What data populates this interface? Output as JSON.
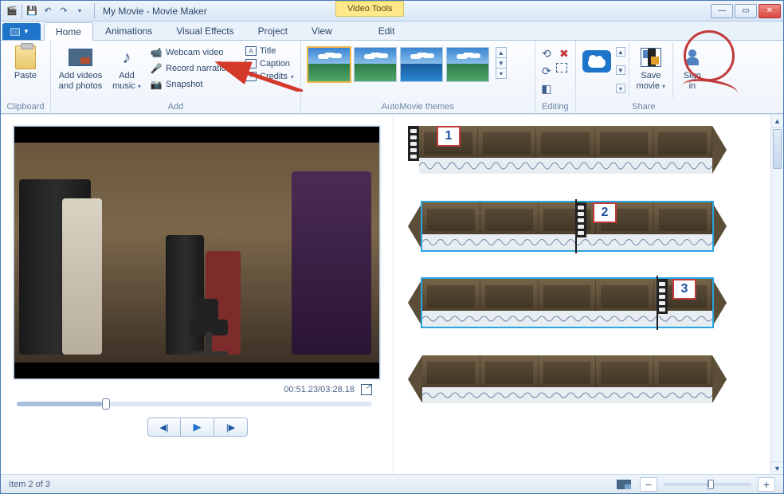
{
  "window_title": "My Movie - Movie Maker",
  "contextual_tab_header": "Video Tools",
  "tabs": {
    "home": "Home",
    "animations": "Animations",
    "visual_effects": "Visual Effects",
    "project": "Project",
    "view": "View",
    "edit": "Edit"
  },
  "ribbon": {
    "clipboard": {
      "paste": "Paste",
      "group": "Clipboard"
    },
    "add": {
      "add_videos": "Add videos\nand photos",
      "add_music": "Add\nmusic",
      "webcam": "Webcam video",
      "record": "Record narration",
      "snapshot": "Snapshot",
      "title": "Title",
      "caption": "Caption",
      "credits": "Credits",
      "group": "Add"
    },
    "themes": {
      "group": "AutoMovie themes"
    },
    "editing": {
      "group": "Editing"
    },
    "share": {
      "save_movie": "Save\nmovie",
      "sign_in": "Sign\nin",
      "group": "Share"
    }
  },
  "preview": {
    "timecode": "00:51.23/03:28.18"
  },
  "controls": {
    "prev": "◀|",
    "play": "▶",
    "next": "|▶"
  },
  "timeline": {
    "markers": {
      "one": "1",
      "two": "2",
      "three": "3"
    }
  },
  "status": {
    "item": "Item 2 of 3"
  }
}
